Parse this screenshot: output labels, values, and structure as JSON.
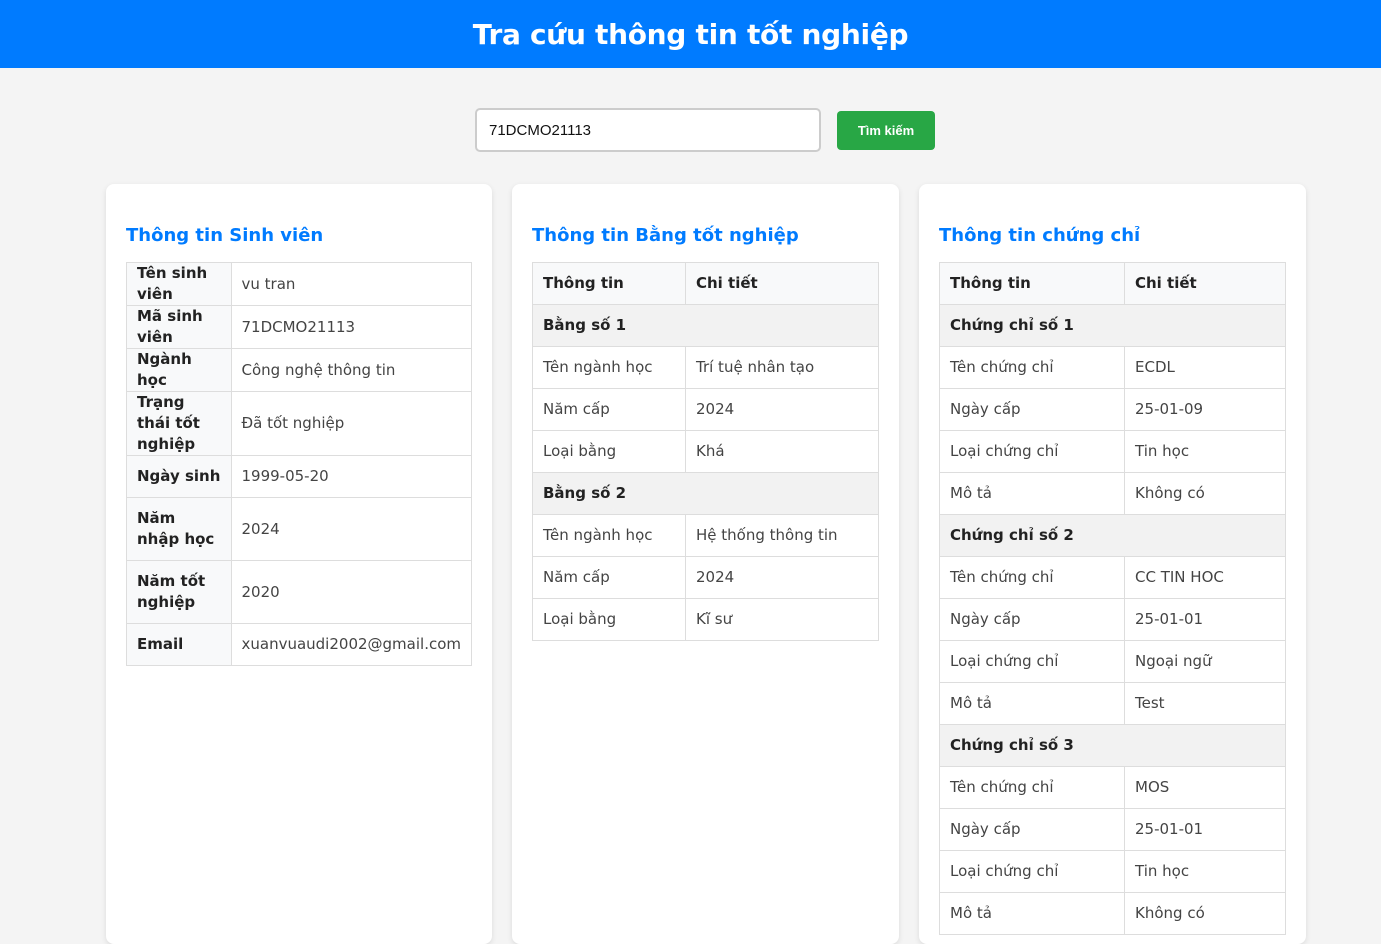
{
  "header": {
    "title": "Tra cứu thông tin tốt nghiệp"
  },
  "search": {
    "value": "71DCMO21113",
    "button_label": "Tìm kiếm"
  },
  "student": {
    "title": "Thông tin Sinh viên",
    "rows": [
      {
        "label": "Tên sinh viên",
        "value": "vu tran"
      },
      {
        "label": "Mã sinh viên",
        "value": "71DCMO21113"
      },
      {
        "label": "Ngành học",
        "value": "Công nghệ thông tin"
      },
      {
        "label": "Trạng thái tốt nghiệp",
        "value": "Đã tốt nghiệp"
      },
      {
        "label": "Ngày sinh",
        "value": "1999-05-20"
      },
      {
        "label": "Năm nhập học",
        "value": "2024"
      },
      {
        "label": "Năm tốt nghiệp",
        "value": "2020"
      },
      {
        "label": "Email",
        "value": "xuanvuaudi2002@gmail.com"
      }
    ]
  },
  "diploma": {
    "title": "Thông tin Bằng tốt nghiệp",
    "headers": [
      "Thông tin",
      "Chi tiết"
    ],
    "groups": [
      {
        "name": "Bằng số 1",
        "rows": [
          {
            "label": "Tên ngành học",
            "value": "Trí tuệ nhân tạo"
          },
          {
            "label": "Năm cấp",
            "value": "2024"
          },
          {
            "label": "Loại bằng",
            "value": "Khá"
          }
        ]
      },
      {
        "name": "Bằng số 2",
        "rows": [
          {
            "label": "Tên ngành học",
            "value": "Hệ thống thông tin"
          },
          {
            "label": "Năm cấp",
            "value": "2024"
          },
          {
            "label": "Loại bằng",
            "value": "Kĩ sư"
          }
        ]
      }
    ]
  },
  "certificate": {
    "title": "Thông tin chứng chỉ",
    "headers": [
      "Thông tin",
      "Chi tiết"
    ],
    "groups": [
      {
        "name": "Chứng chỉ số 1",
        "rows": [
          {
            "label": "Tên chứng chỉ",
            "value": "ECDL"
          },
          {
            "label": "Ngày cấp",
            "value": "25-01-09"
          },
          {
            "label": "Loại chứng chỉ",
            "value": "Tin học"
          },
          {
            "label": "Mô tả",
            "value": "Không có"
          }
        ]
      },
      {
        "name": "Chứng chỉ số 2",
        "rows": [
          {
            "label": "Tên chứng chỉ",
            "value": "CC TIN HOC"
          },
          {
            "label": "Ngày cấp",
            "value": "25-01-01"
          },
          {
            "label": "Loại chứng chỉ",
            "value": "Ngoại ngữ"
          },
          {
            "label": "Mô tả",
            "value": "Test"
          }
        ]
      },
      {
        "name": "Chứng chỉ số 3",
        "rows": [
          {
            "label": "Tên chứng chỉ",
            "value": "MOS"
          },
          {
            "label": "Ngày cấp",
            "value": "25-01-01"
          },
          {
            "label": "Loại chứng chỉ",
            "value": "Tin học"
          },
          {
            "label": "Mô tả",
            "value": "Không có"
          }
        ]
      }
    ]
  }
}
